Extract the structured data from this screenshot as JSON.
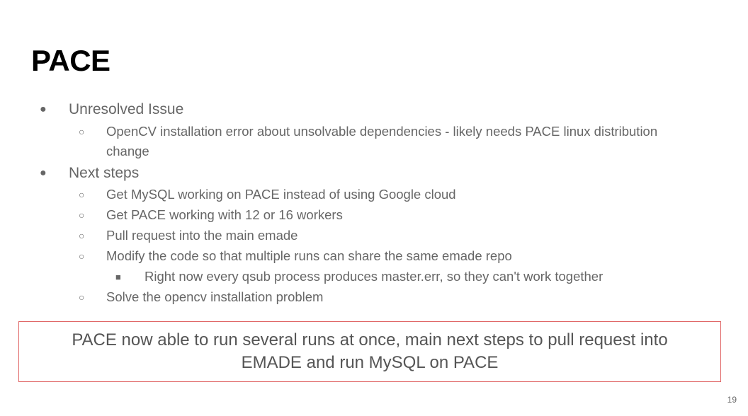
{
  "slide": {
    "title": "PACE",
    "items": [
      {
        "bullet": "●",
        "text": "Unresolved Issue",
        "children": [
          {
            "bullet": "○",
            "text": "OpenCV installation error about unsolvable dependencies - likely needs PACE linux distribution change"
          }
        ]
      },
      {
        "bullet": "●",
        "text": "Next steps",
        "children": [
          {
            "bullet": "○",
            "text": "Get MySQL working on PACE instead of using Google cloud"
          },
          {
            "bullet": "○",
            "text": "Get PACE working with 12 or 16 workers"
          },
          {
            "bullet": "○",
            "text": "Pull request into the main emade"
          },
          {
            "bullet": "○",
            "text": "Modify the code so that multiple runs can share the same emade repo",
            "children": [
              {
                "bullet": "■",
                "text": "Right now every qsub process produces master.err, so they can't work together"
              }
            ]
          },
          {
            "bullet": "○",
            "text": "Solve the opencv installation problem"
          }
        ]
      }
    ],
    "callout": "PACE now able to run several runs at once, main next steps to pull request into EMADE and run MySQL on PACE",
    "page_number": "19"
  },
  "colors": {
    "title": "#000000",
    "body_text": "#666666",
    "callout_border": "#e06666",
    "callout_text": "#555555",
    "background": "#ffffff"
  }
}
